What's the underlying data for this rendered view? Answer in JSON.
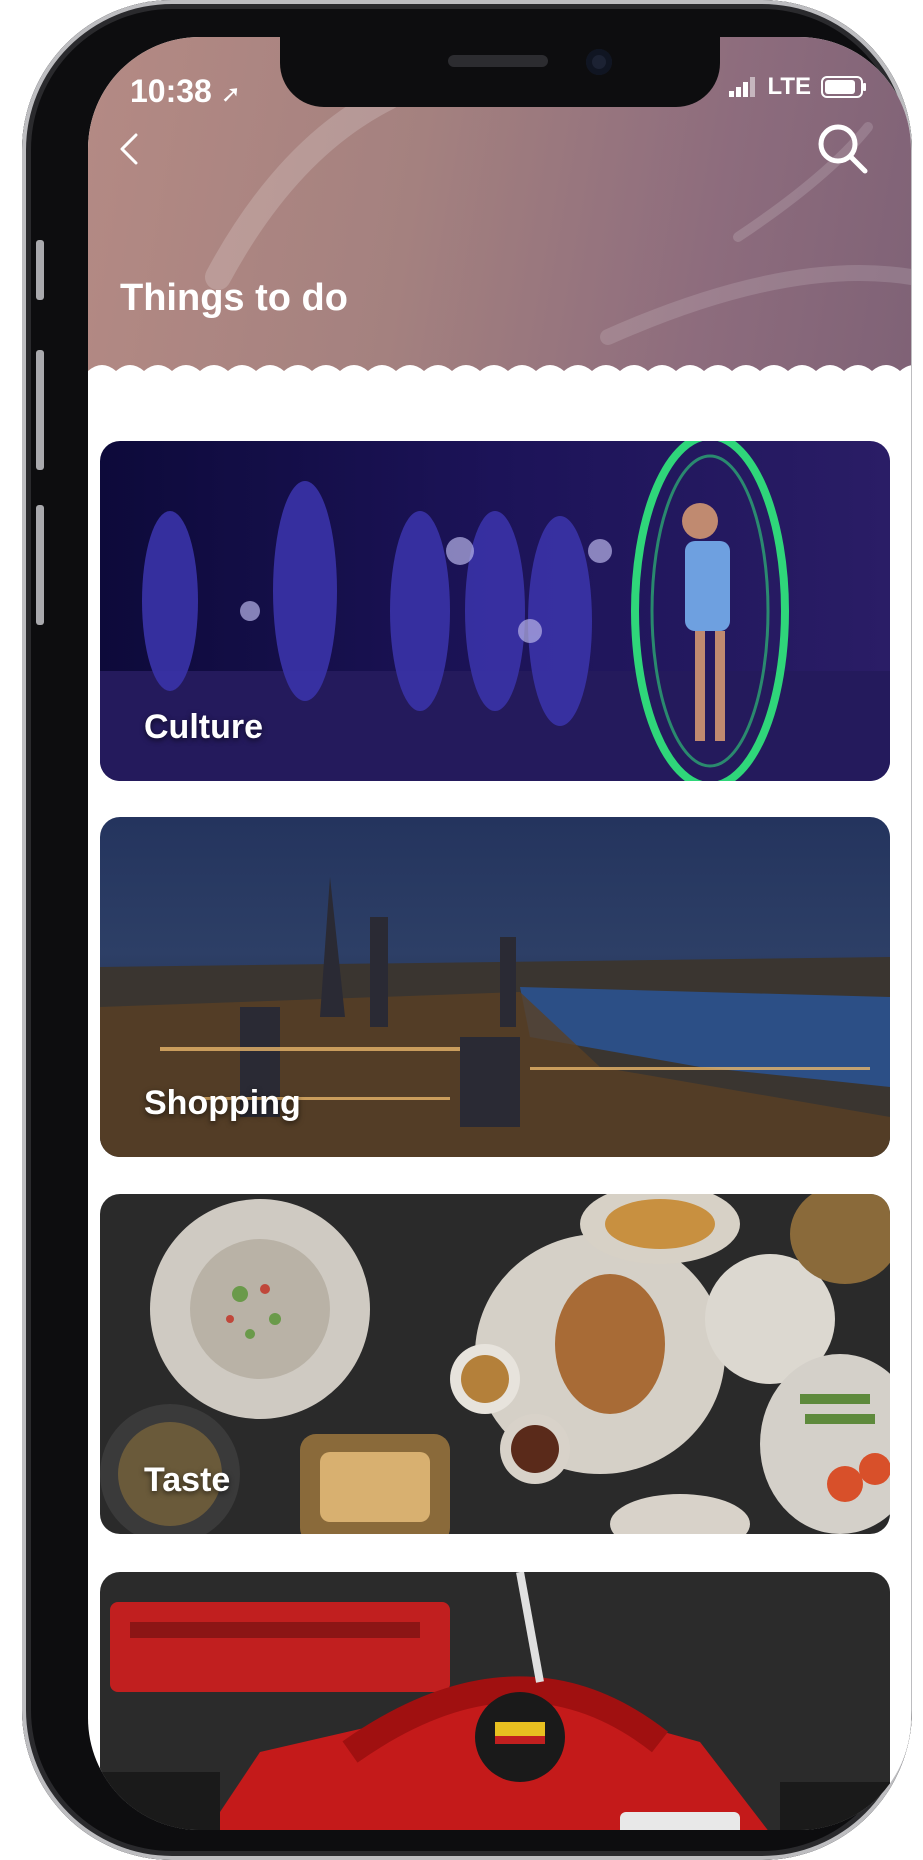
{
  "status_bar": {
    "time": "10:38",
    "network": "LTE"
  },
  "header": {
    "title": "Things to do",
    "back_icon": "chevron-left-icon",
    "search_icon": "search-icon",
    "gradient_colors": [
      "#b48a84",
      "#7f6276"
    ]
  },
  "categories": [
    {
      "label": "Culture",
      "image": "stage-performance-image"
    },
    {
      "label": "Shopping",
      "image": "city-skyline-night-image"
    },
    {
      "label": "Taste",
      "image": "food-dishes-image"
    },
    {
      "label": "",
      "image": "race-car-image"
    }
  ]
}
